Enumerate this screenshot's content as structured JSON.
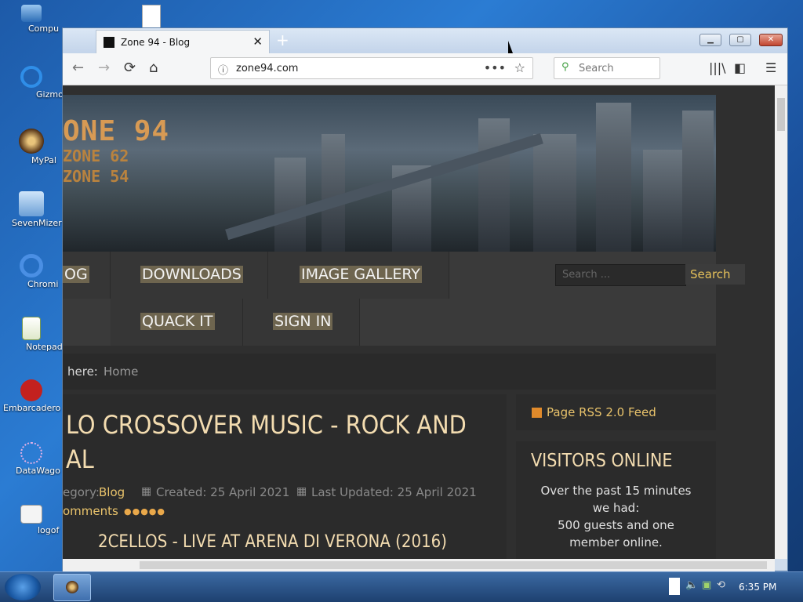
{
  "desktop": {
    "icons": [
      {
        "label": "Compu",
        "name": "computer-icon"
      },
      {
        "label": "Gizmo",
        "name": "gizmo-icon"
      },
      {
        "label": "MyPal",
        "name": "mypal-icon"
      },
      {
        "label": "SevenMizer",
        "name": "sevenmizer-icon"
      },
      {
        "label": "Chromi",
        "name": "chromium-icon"
      },
      {
        "label": "Notepad",
        "name": "notepad-icon"
      },
      {
        "label": "Embarcadero",
        "name": "embarcadero-icon"
      },
      {
        "label": "DataWago",
        "name": "datawagon-icon"
      },
      {
        "label": "logof",
        "name": "logoff-icon"
      }
    ]
  },
  "browser": {
    "tab_title": "Zone 94 - Blog",
    "url": "zone94.com",
    "search_placeholder": "Search"
  },
  "site": {
    "logo_line1": "ONE 94",
    "logo_line2": "ZONE 62",
    "logo_line3": "ZONE 54",
    "menu": [
      "OG",
      "DOWNLOADS",
      "IMAGE GALLERY",
      "QUACK IT",
      "SIGN IN"
    ],
    "search_placeholder": "Search ...",
    "search_button": "Search",
    "breadcrumb_prefix": "here:",
    "breadcrumb_home": "Home",
    "article": {
      "title_line1": "LO CROSSOVER MUSIC - ROCK AND",
      "title_line2": "AL",
      "category_label": "egory:",
      "category_value": "Blog",
      "created": "Created: 25 April 2021",
      "updated": "Last Updated: 25 April 2021",
      "comments": "omments",
      "subtitle": "2CELLOS - LIVE AT ARENA DI VERONA (2016)"
    },
    "sidebar": {
      "rss": "Page RSS 2.0 Feed",
      "visitors_title": "VISITORS ONLINE",
      "visitors_text": "Over the past 15 minutes we had:",
      "visitors_text2": "500 guests and one member online."
    }
  },
  "taskbar": {
    "clock": "6:35 PM"
  }
}
